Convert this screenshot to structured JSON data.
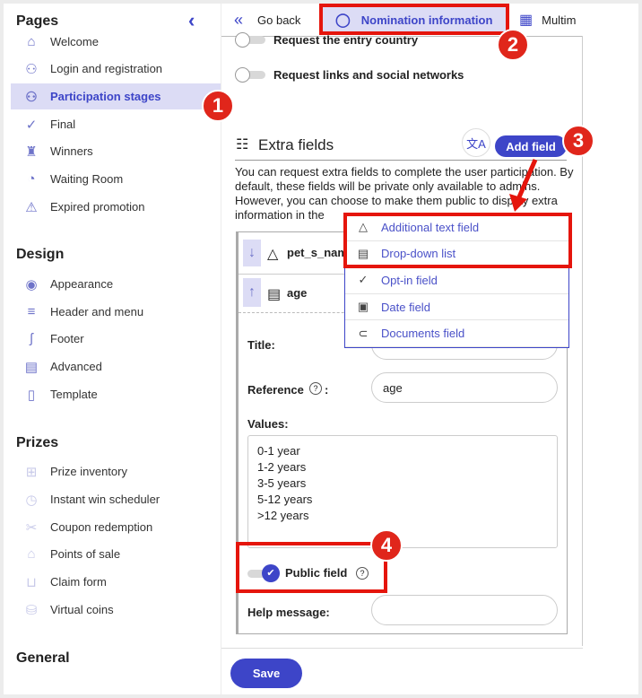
{
  "sidebar": {
    "sections": [
      {
        "title": "Pages",
        "items": [
          {
            "label": "Welcome",
            "icon": "home-icon"
          },
          {
            "label": "Login and registration",
            "icon": "user-lock-icon"
          },
          {
            "label": "Participation stages",
            "icon": "user-icon",
            "active": true
          },
          {
            "label": "Final",
            "icon": "check-icon"
          },
          {
            "label": "Winners",
            "icon": "trophy-icon"
          },
          {
            "label": "Waiting Room",
            "icon": "gauge-icon"
          },
          {
            "label": "Expired promotion",
            "icon": "warning-icon"
          }
        ]
      },
      {
        "title": "Design",
        "items": [
          {
            "label": "Appearance",
            "icon": "palette-icon"
          },
          {
            "label": "Header and menu",
            "icon": "menu-icon"
          },
          {
            "label": "Footer",
            "icon": "footprint-icon"
          },
          {
            "label": "Advanced",
            "icon": "code-doc-icon"
          },
          {
            "label": "Template",
            "icon": "file-icon"
          }
        ]
      },
      {
        "title": "Prizes",
        "items": [
          {
            "label": "Prize inventory",
            "icon": "gift-icon"
          },
          {
            "label": "Instant win scheduler",
            "icon": "stopwatch-icon"
          },
          {
            "label": "Coupon redemption",
            "icon": "coupon-icon"
          },
          {
            "label": "Points of sale",
            "icon": "store-icon"
          },
          {
            "label": "Claim form",
            "icon": "hand-gift-icon"
          },
          {
            "label": "Virtual coins",
            "icon": "coins-icon"
          }
        ]
      },
      {
        "title": "General",
        "items": []
      }
    ],
    "collapse_icon": "chevron-left-icon"
  },
  "tabs": {
    "go_back": "Go back",
    "nomination": "Nomination information",
    "multimedia": "Multim"
  },
  "toggles": {
    "entry_country": "Request the entry country",
    "social": "Request links and social networks"
  },
  "extra": {
    "title": "Extra fields",
    "add_field": "Add field",
    "description": "You can request extra fields to complete the user participation. By default, these fields will be private only available to admins. However, you can choose to make them public to display extra information in the"
  },
  "dropdown": [
    {
      "label": "Additional text field",
      "icon": "text-field-icon"
    },
    {
      "label": "Drop-down list",
      "icon": "dropdown-list-icon"
    },
    {
      "label": "Opt-in field",
      "icon": "checkmark-icon"
    },
    {
      "label": "Date field",
      "icon": "calendar-icon"
    },
    {
      "label": "Documents field",
      "icon": "paperclip-icon"
    }
  ],
  "fields": [
    {
      "name": "pet_s_name"
    },
    {
      "name": "age"
    }
  ],
  "form": {
    "title_label": "Title:",
    "reference_label": "Reference",
    "reference_value": "age",
    "values_label": "Values:",
    "values": [
      "0-1 year",
      "1-2 years",
      "3-5 years",
      "5-12 years",
      ">12 years"
    ],
    "public_field": "Public field",
    "public_checked": true,
    "help_label": "Help message:",
    "help_value": ""
  },
  "save": "Save",
  "badges": [
    "1",
    "2",
    "3",
    "4"
  ],
  "colors": {
    "accent": "#3d45c8",
    "annotation": "#e5150c"
  }
}
